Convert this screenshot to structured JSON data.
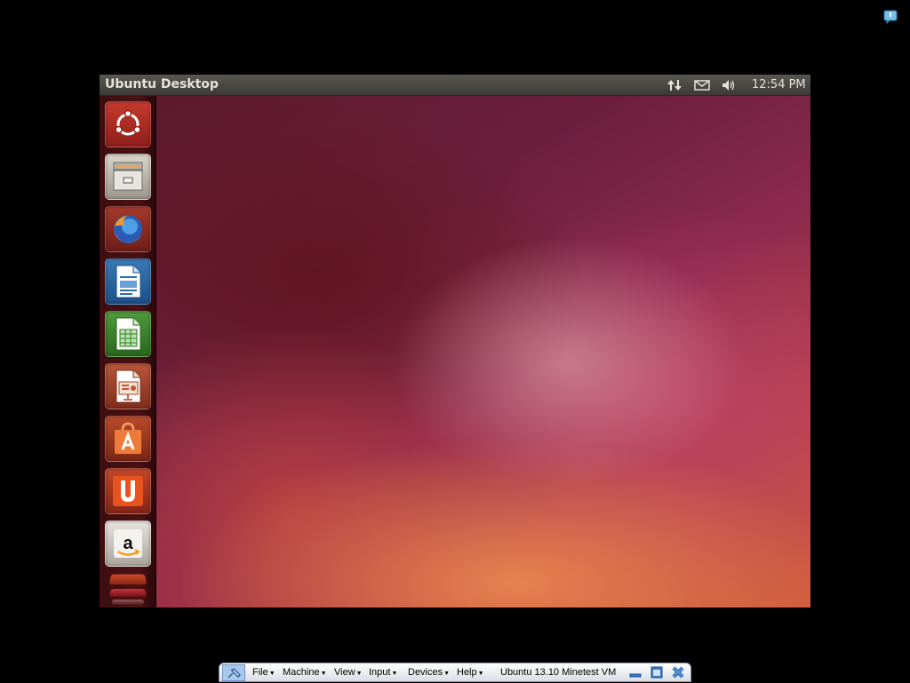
{
  "vm_panel": {
    "title": "Ubuntu Desktop",
    "clock": "12:54 PM",
    "indicators": [
      "network-updown-icon",
      "mail-envelope-icon",
      "volume-icon"
    ]
  },
  "launcher": {
    "items": [
      {
        "name": "dash-home",
        "icon": "ubuntu-logo-icon"
      },
      {
        "name": "files",
        "icon": "file-cabinet-icon"
      },
      {
        "name": "firefox",
        "icon": "firefox-icon"
      },
      {
        "name": "libreoffice-writer",
        "icon": "writer-document-icon"
      },
      {
        "name": "libreoffice-calc",
        "icon": "calc-spreadsheet-icon"
      },
      {
        "name": "libreoffice-impress",
        "icon": "impress-presentation-icon"
      },
      {
        "name": "ubuntu-software-center",
        "icon": "shopping-bag-icon"
      },
      {
        "name": "ubuntu-one",
        "icon": "ubuntu-one-icon"
      },
      {
        "name": "amazon",
        "icon": "amazon-icon"
      }
    ]
  },
  "vbox_toolbar": {
    "menus": [
      "File",
      "Machine",
      "View",
      "Input",
      "Devices",
      "Help"
    ],
    "vm_name": "Ubuntu 13.10 Minetest VM"
  },
  "colors": {
    "panel_text": "#e6e2da",
    "launcher_bg": "#4a1114",
    "wallpaper_accent": "#cf5a3e"
  }
}
